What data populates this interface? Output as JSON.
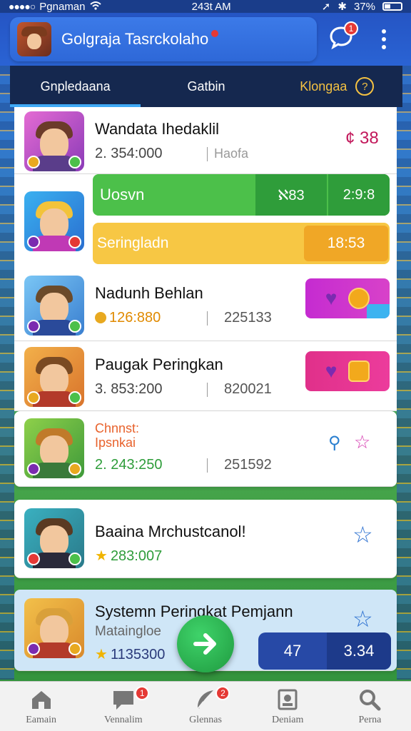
{
  "status_bar": {
    "carrier": "Pgnaman",
    "time": "243t AM",
    "battery": "37%"
  },
  "header": {
    "title": "Golgraja Tasrckolaho",
    "chat_badge": "1"
  },
  "tabs": [
    {
      "label": "Gnpledaana"
    },
    {
      "label": "Gatbin"
    },
    {
      "label": "Klongaa",
      "help": "?"
    }
  ],
  "rows": {
    "r1": {
      "name": "Wandata Ihedaklil",
      "score": "2. 354:000",
      "sub": "Haofa",
      "right_value": "¢ 38"
    },
    "highlight": {
      "green_label": "Uosvn",
      "green_seg1": "ℵ83",
      "green_seg2": "2:9:8",
      "yellow_label": "Seringladn",
      "yellow_seg": "18:53"
    },
    "r3": {
      "name": "Nadunh Behlan",
      "score": "126:880",
      "sub": "225133"
    },
    "r4": {
      "name": "Paugak Peringkan",
      "score": "3. 853:200",
      "sub": "820021"
    },
    "r5": {
      "name_line1": "Chnnst:",
      "name_line2": "Ipsnkai",
      "score": "2. 243:250",
      "sub": "251592"
    },
    "r6": {
      "name": "Baaina Mrchustcanol!",
      "score": "283:007"
    },
    "r7": {
      "name": "Systemn Peringkat Pemjann",
      "sub_label": "Mataingloe",
      "score": "1135300"
    }
  },
  "score_pill": {
    "a": "47",
    "b": "3.34"
  },
  "bottom_nav": [
    {
      "label": "Eamain",
      "icon": "home-icon"
    },
    {
      "label": "Vennalim",
      "icon": "chat-icon",
      "badge": "1"
    },
    {
      "label": "Glennas",
      "icon": "feather-icon",
      "badge": "2"
    },
    {
      "label": "Deniam",
      "icon": "photo-icon"
    },
    {
      "label": "Perna",
      "icon": "search-icon"
    }
  ],
  "colors": {
    "app_bar": "#2a63d4",
    "tab_bar": "#15284f",
    "green": "#4cc04a",
    "yellow": "#f7c744",
    "magenta": "#c52bd1",
    "pink": "#e0308a",
    "navy_pill": "#2749a6"
  }
}
